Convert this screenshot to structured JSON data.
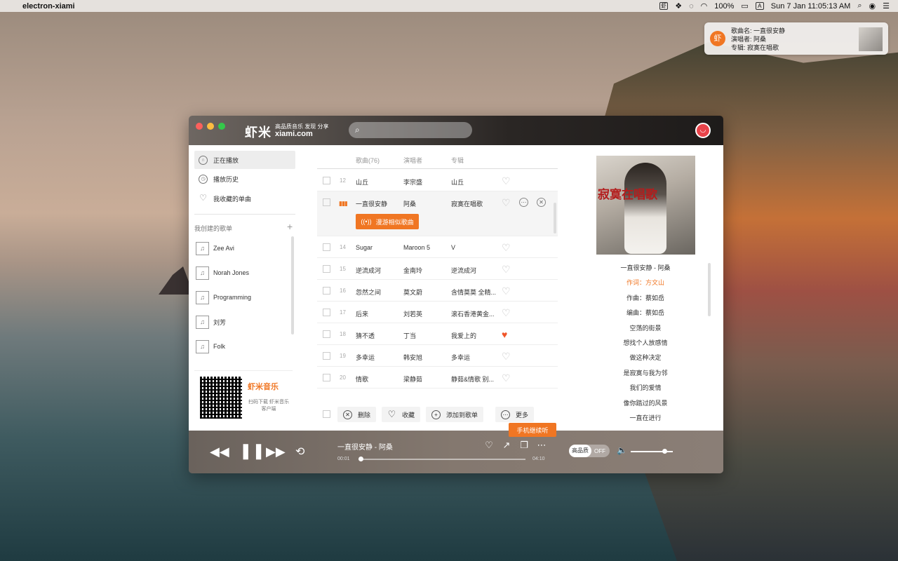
{
  "menubar": {
    "app_name": "electron-xiami",
    "xiami_icon": "虾",
    "battery": "100%",
    "input_source": "A",
    "datetime": "Sun 7 Jan  11:05:13 AM"
  },
  "notification": {
    "icon_char": "虾",
    "line1": "歌曲名: 一直很安静",
    "line2": "演唱者: 阿桑",
    "line3": "专辑: 寂寞在唱歌"
  },
  "header": {
    "logo": "虾米",
    "slogan": "高品质音乐 发现 分享",
    "logo_en": "xiami.com",
    "search_placeholder": ""
  },
  "sidebar": {
    "nav": [
      {
        "label": "正在播放"
      },
      {
        "label": "播放历史"
      },
      {
        "label": "我收藏的单曲"
      }
    ],
    "section_title": "我创建的歌单",
    "section_add": "+",
    "playlists": [
      {
        "label": "Zee Avi"
      },
      {
        "label": "Norah Jones"
      },
      {
        "label": "Programming"
      },
      {
        "label": "刘芳"
      },
      {
        "label": "Folk"
      }
    ],
    "qr": {
      "brand": "虾米音乐",
      "text": "扫码下载 虾米音乐客户端"
    }
  },
  "songs": {
    "headers": {
      "name": "歌曲(76)",
      "artist": "演唱者",
      "album": "专辑"
    },
    "rows": [
      {
        "num": "12",
        "name": "山丘",
        "artist": "李宗盛",
        "album": "山丘",
        "liked": false
      },
      {
        "num": "",
        "name": "一直很安静",
        "artist": "阿桑",
        "album": "寂寞在唱歌",
        "liked": false,
        "playing": true
      },
      {
        "num": "14",
        "name": "Sugar",
        "artist": "Maroon 5",
        "album": "V",
        "liked": false
      },
      {
        "num": "15",
        "name": "逆流成河",
        "artist": "金南玲",
        "album": "逆流成河",
        "liked": false
      },
      {
        "num": "16",
        "name": "忽然之间",
        "artist": "莫文蔚",
        "album": "含情莫莫 全精...",
        "liked": false
      },
      {
        "num": "17",
        "name": "后来",
        "artist": "刘若英",
        "album": "滚石香港黄金...",
        "liked": false
      },
      {
        "num": "18",
        "name": "猜不透",
        "artist": "丁当",
        "album": "我爱上的",
        "liked": true
      },
      {
        "num": "19",
        "name": "多幸运",
        "artist": "韩安旭",
        "album": "多幸运",
        "liked": false
      },
      {
        "num": "20",
        "name": "情歌",
        "artist": "梁静茹",
        "album": "静茹&情歌 别...",
        "liked": false
      }
    ],
    "roam_label": "漫游相似歌曲",
    "toolbar": {
      "delete": "删除",
      "collect": "收藏",
      "add_to": "添加到歌单",
      "more": "更多"
    }
  },
  "lyrics": {
    "cover_title": "寂寞在唱歌",
    "lines": [
      "一直很安静 - 阿桑",
      "作词：方文山",
      "作曲：蔡如岳",
      "编曲：蔡如岳",
      "空荡的街景",
      "想找个人放感情",
      "做这种决定",
      "是寂寞与我为邻",
      "我们的爱情",
      "像你踏过的风景",
      "一直在进行"
    ],
    "highlight_index": 1
  },
  "player": {
    "title": "一直很安静 - 阿桑",
    "time_current": "00:01",
    "time_total": "04:10",
    "progress": 0.01,
    "hq_label": "高品质",
    "hq_state": "OFF",
    "volume": 0.8,
    "continue_label": "手机继续听"
  },
  "colors": {
    "accent": "#f07623",
    "liked": "#f0562a"
  }
}
